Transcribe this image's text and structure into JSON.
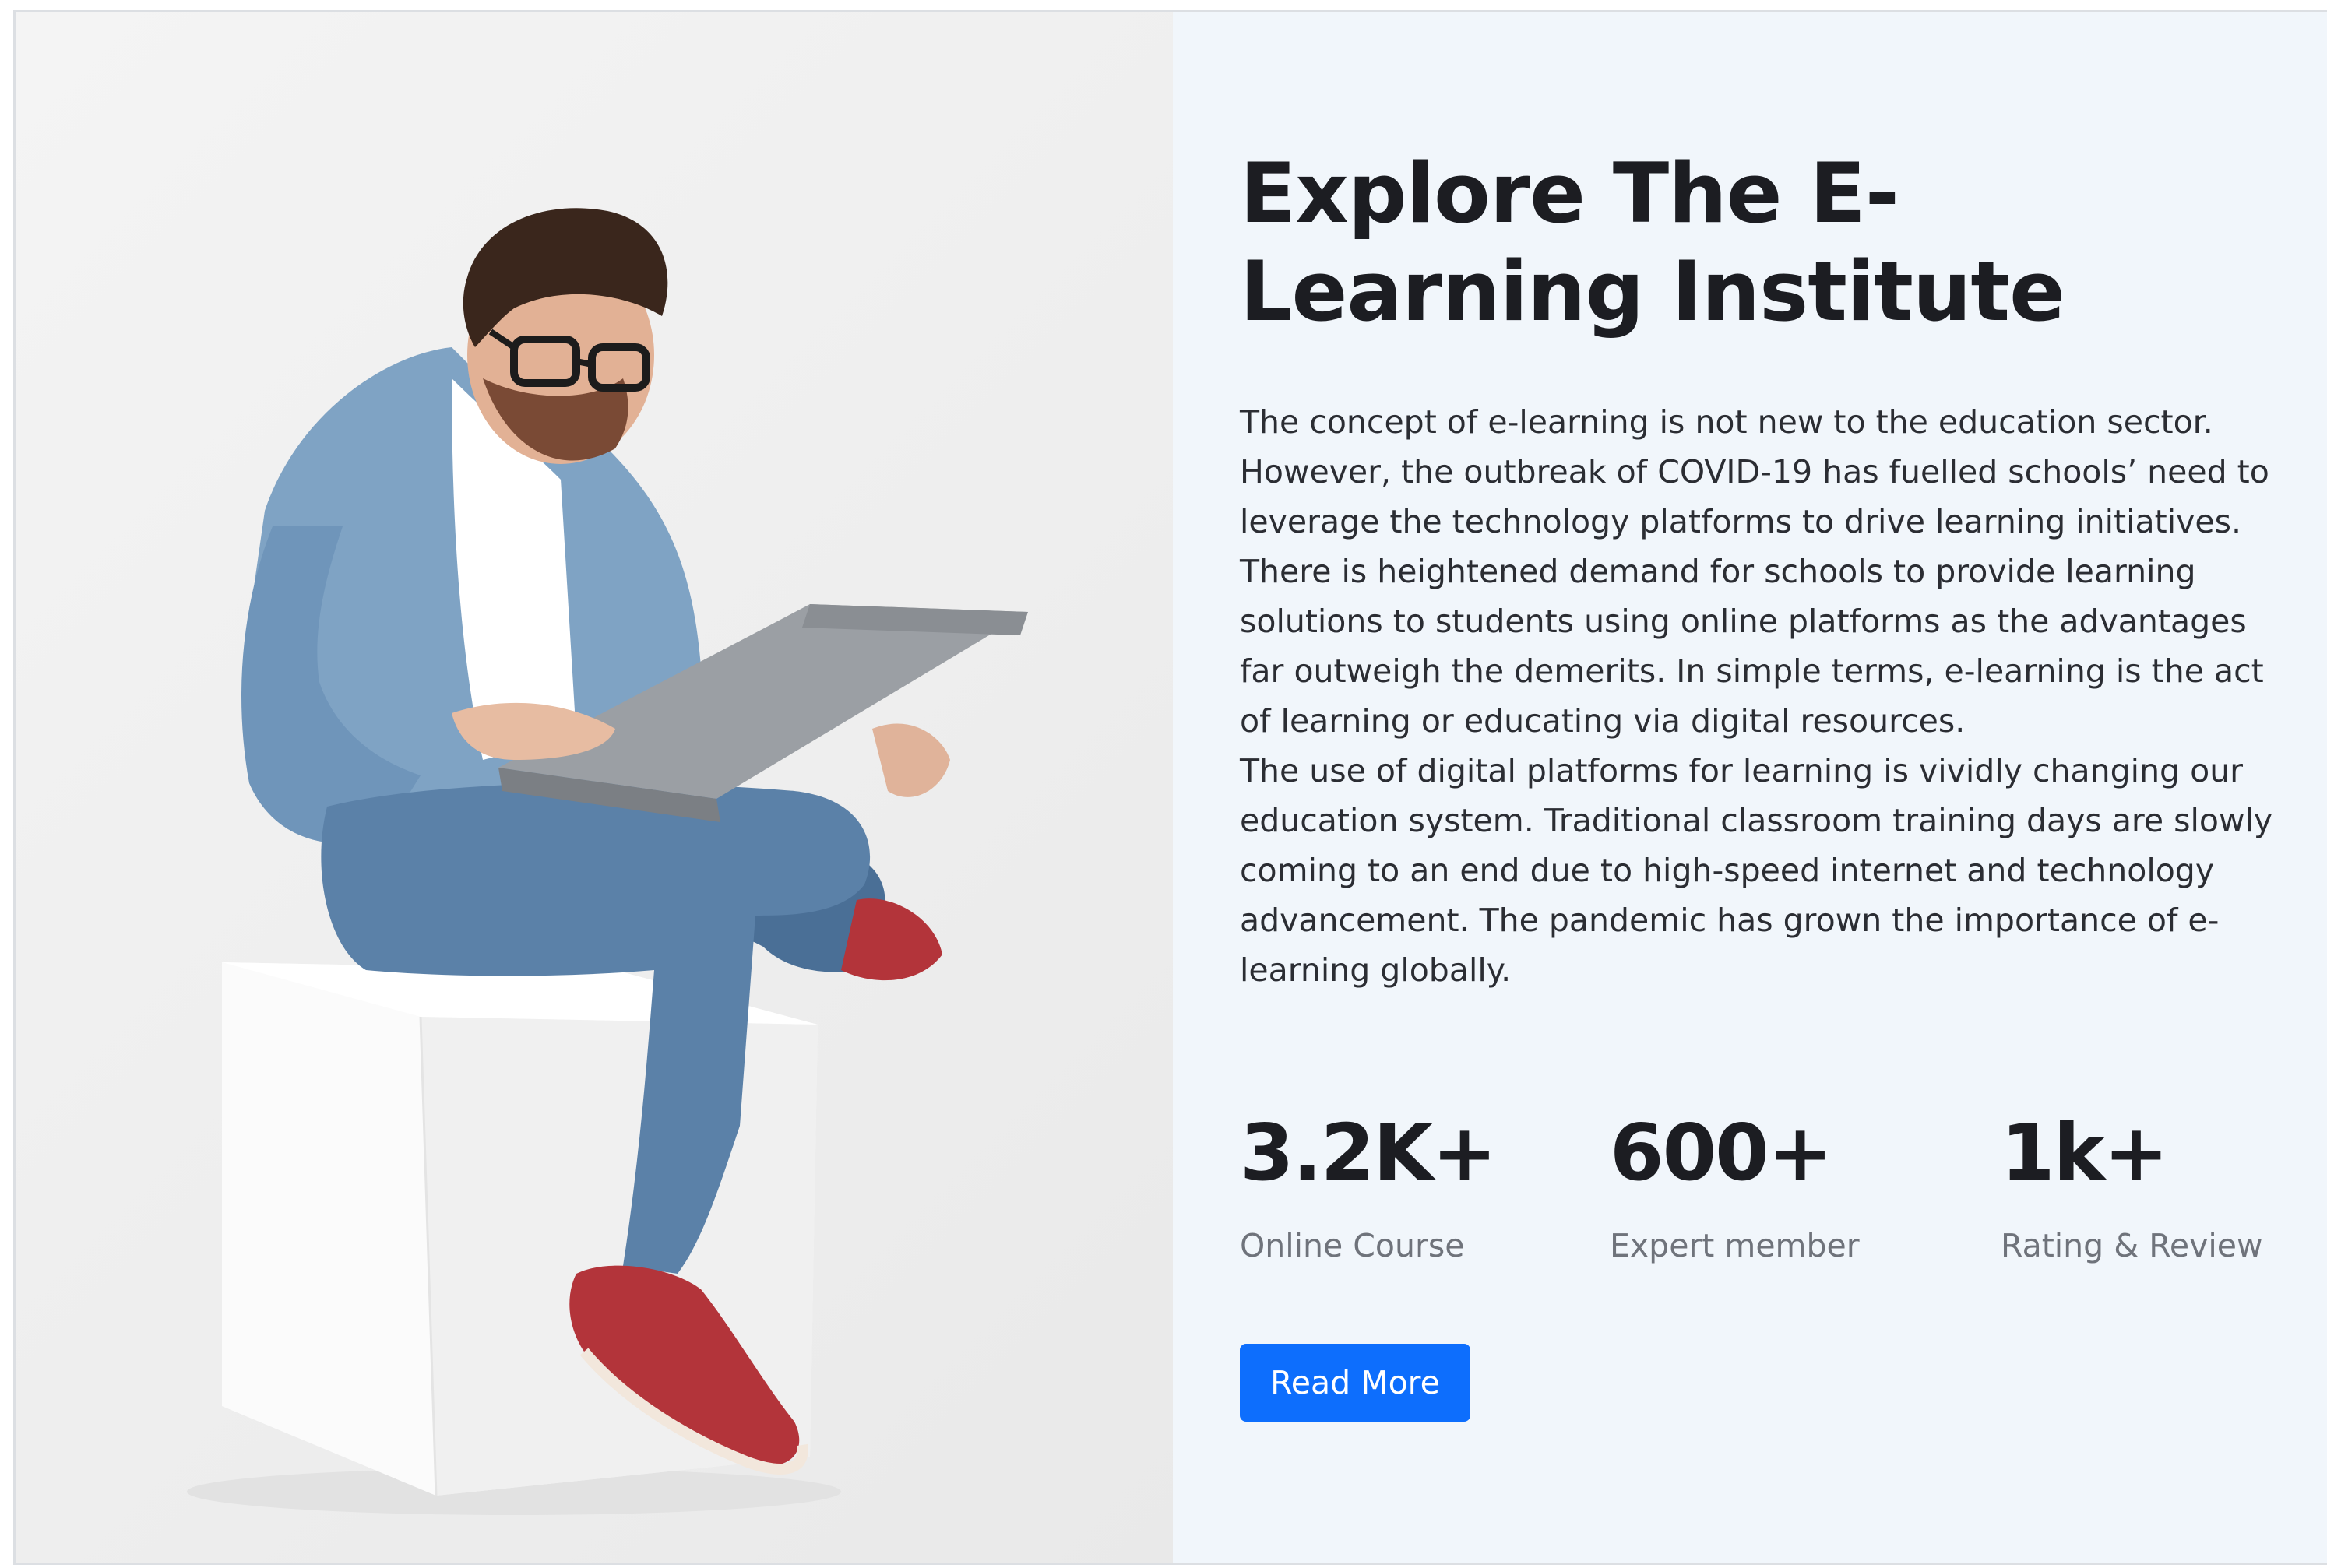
{
  "about": {
    "heading": "Explore The E-Learning Institute",
    "paragraphs": [
      "The concept of e-learning is not new to the education sector. However, the outbreak of COVID-19 has fuelled schools’ need to leverage the technology platforms to drive learning initiatives. There is heightened demand for schools to provide learning solutions to students using online platforms as the advantages far outweigh the demerits. In simple terms, e-learning is the act of learning or educating via digital resources.",
      "The use of digital platforms for learning is vividly changing our education system. Traditional classroom training days are slowly coming to an end due to high-speed internet and technology advancement. The pandemic has grown the importance of e-learning globally."
    ],
    "stats": [
      {
        "value": "3.2K+",
        "label": "Online Course"
      },
      {
        "value": "600+",
        "label": "Expert member"
      },
      {
        "value": "1k+",
        "label": "Rating & Review"
      }
    ],
    "button_label": "Read More"
  },
  "colors": {
    "accent": "#0d6efd",
    "panel_background": "#f1f6fb",
    "heading_text": "#1c1d22",
    "muted_text": "#6f737b"
  }
}
